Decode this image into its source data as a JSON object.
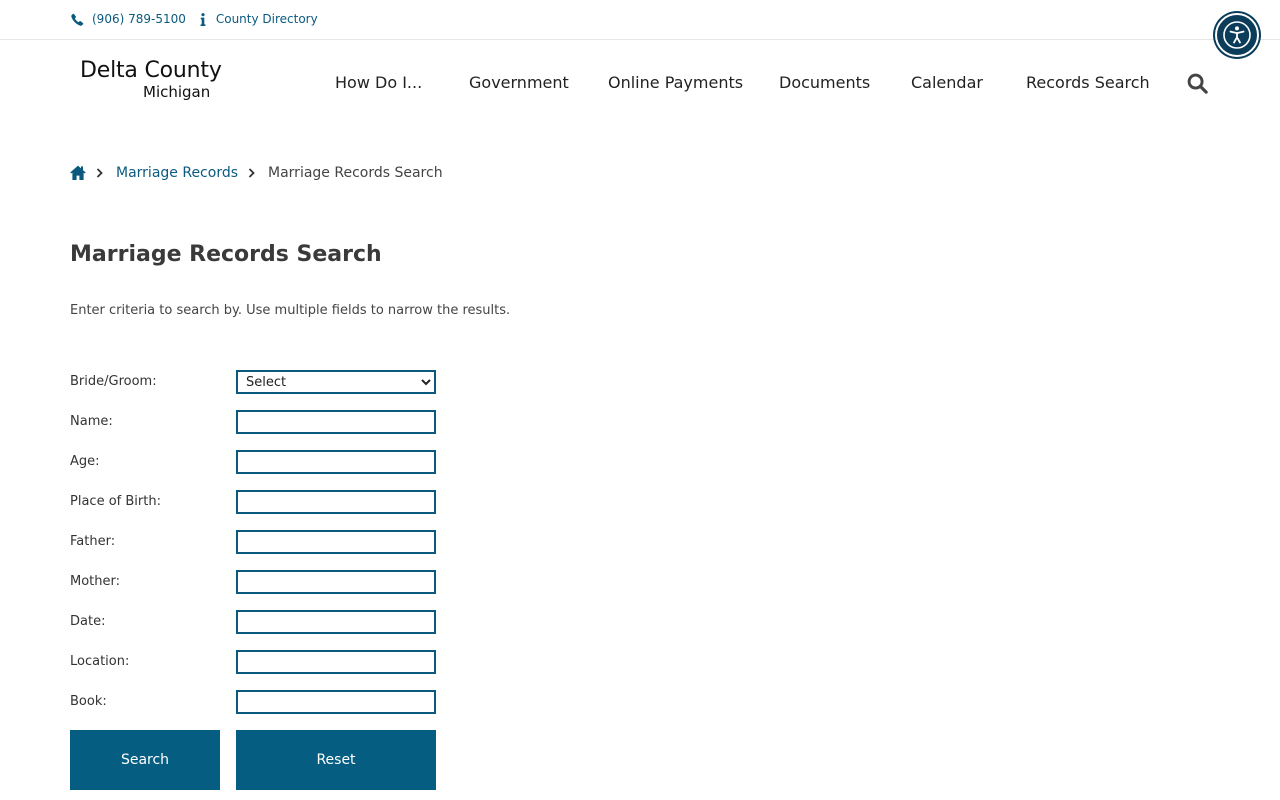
{
  "topbar": {
    "phone": "(906) 789-5100",
    "directory": "County Directory"
  },
  "logo": {
    "line1": "Delta County",
    "line2": "Michigan"
  },
  "nav": {
    "items": [
      "How Do I...",
      "Government",
      "Online Payments",
      "Documents",
      "Calendar",
      "Records Search"
    ]
  },
  "breadcrumb": {
    "link": "Marriage Records",
    "current": "Marriage Records Search"
  },
  "page": {
    "title": "Marriage Records Search",
    "intro": "Enter criteria to search by. Use multiple fields to narrow the results."
  },
  "form": {
    "bride_groom": {
      "label": "Bride/Groom:",
      "selected": "Select"
    },
    "fields": [
      {
        "label": "Name:",
        "value": ""
      },
      {
        "label": "Age:",
        "value": ""
      },
      {
        "label": "Place of Birth:",
        "value": ""
      },
      {
        "label": "Father:",
        "value": ""
      },
      {
        "label": "Mother:",
        "value": ""
      },
      {
        "label": "Date:",
        "value": ""
      },
      {
        "label": "Location:",
        "value": ""
      },
      {
        "label": "Book:",
        "value": ""
      }
    ],
    "search_label": "Search",
    "reset_label": "Reset"
  },
  "colors": {
    "accent": "#0b5a7e",
    "button": "#055e82",
    "a11y": "#0b3d5b"
  },
  "icons": [
    "phone-icon",
    "info-icon",
    "accessibility-icon",
    "search-icon",
    "home-icon",
    "chevron-right-icon"
  ]
}
